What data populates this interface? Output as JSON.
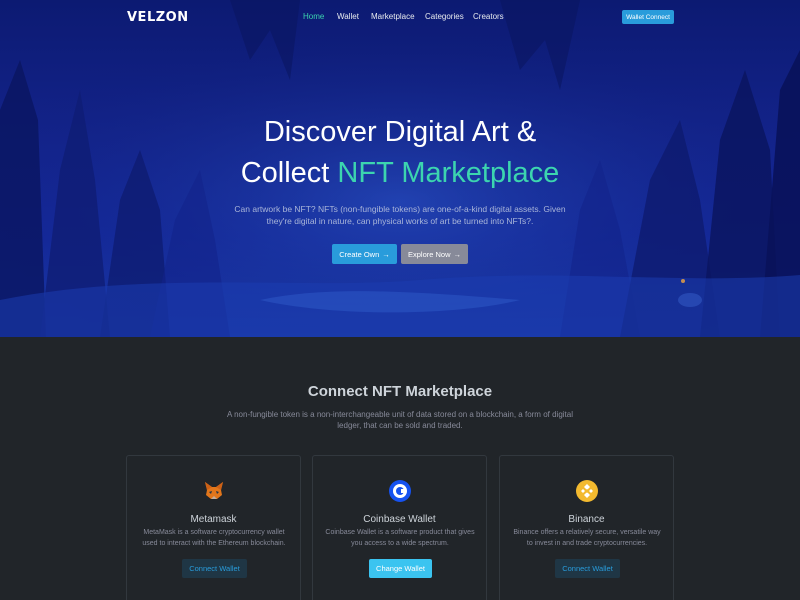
{
  "brand": "VELZON",
  "nav": {
    "links": [
      "Home",
      "Wallet",
      "Marketplace",
      "Categories",
      "Creators"
    ],
    "cta": "Wallet Connect"
  },
  "hero": {
    "title_line1": "Discover Digital Art &",
    "title_line2_plain": "Collect",
    "title_line2_accent": "NFT Marketplace",
    "subtitle": "Can artwork be NFT? NFTs (non-fungible tokens) are one-of-a-kind digital assets. Given they're digital in nature, can physical works of art be turned into NFTs?.",
    "btn_create": "Create Own",
    "btn_explore": "Explore Now"
  },
  "section": {
    "title": "Connect NFT Marketplace",
    "subtitle": "A non-fungible token is a non-interchangeable unit of data stored on a blockchain, a form of digital ledger, that can be sold and traded."
  },
  "cards": [
    {
      "icon": "metamask-fox-icon",
      "title": "Metamask",
      "desc": "MetaMask is a software cryptocurrency wallet used to interact with the Ethereum blockchain.",
      "button": "Connect Wallet"
    },
    {
      "icon": "coinbase-icon",
      "title": "Coinbase Wallet",
      "desc": "Coinbase Wallet is a software product that gives you access to a wide spectrum.",
      "button": "Change Wallet"
    },
    {
      "icon": "binance-icon",
      "title": "Binance",
      "desc": "Binance offers a relatively secure, versatile way to invest in and trade cryptocurrencies.",
      "button": "Connect Wallet"
    }
  ],
  "colors": {
    "accent": "#3cd5af",
    "primary": "#299cdb",
    "secondary": "#878a99",
    "info": "#3bc4f0",
    "dark_bg": "#212529"
  }
}
